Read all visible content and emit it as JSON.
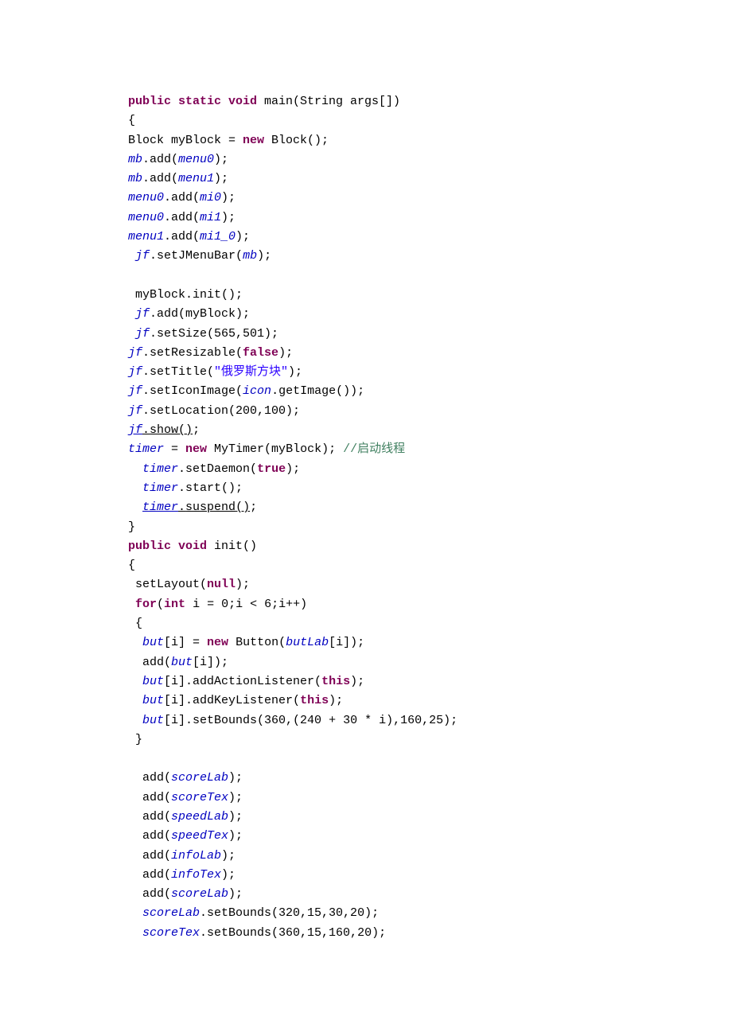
{
  "code_lines": [
    {
      "indent": "",
      "tokens": [
        {
          "class": "kw",
          "text": "public static void"
        },
        {
          "class": "normal",
          "text": " main(String args[])"
        }
      ]
    },
    {
      "indent": "",
      "tokens": [
        {
          "class": "normal",
          "text": "{"
        }
      ]
    },
    {
      "indent": "",
      "tokens": [
        {
          "class": "normal",
          "text": "Block myBlock = "
        },
        {
          "class": "kw",
          "text": "new"
        },
        {
          "class": "normal",
          "text": " Block();"
        }
      ]
    },
    {
      "indent": "",
      "tokens": [
        {
          "class": "field",
          "text": "mb"
        },
        {
          "class": "normal",
          "text": ".add("
        },
        {
          "class": "field",
          "text": "menu0"
        },
        {
          "class": "normal",
          "text": ");"
        }
      ]
    },
    {
      "indent": "",
      "tokens": [
        {
          "class": "field",
          "text": "mb"
        },
        {
          "class": "normal",
          "text": ".add("
        },
        {
          "class": "field",
          "text": "menu1"
        },
        {
          "class": "normal",
          "text": ");"
        }
      ]
    },
    {
      "indent": "",
      "tokens": [
        {
          "class": "field",
          "text": "menu0"
        },
        {
          "class": "normal",
          "text": ".add("
        },
        {
          "class": "field",
          "text": "mi0"
        },
        {
          "class": "normal",
          "text": ");"
        }
      ]
    },
    {
      "indent": "",
      "tokens": [
        {
          "class": "field",
          "text": "menu0"
        },
        {
          "class": "normal",
          "text": ".add("
        },
        {
          "class": "field",
          "text": "mi1"
        },
        {
          "class": "normal",
          "text": ");"
        }
      ]
    },
    {
      "indent": "",
      "tokens": [
        {
          "class": "field",
          "text": "menu1"
        },
        {
          "class": "normal",
          "text": ".add("
        },
        {
          "class": "field",
          "text": "mi1_0"
        },
        {
          "class": "normal",
          "text": ");"
        }
      ]
    },
    {
      "indent": " ",
      "tokens": [
        {
          "class": "field",
          "text": "jf"
        },
        {
          "class": "normal",
          "text": ".setJMenuBar("
        },
        {
          "class": "field",
          "text": "mb"
        },
        {
          "class": "normal",
          "text": ");"
        }
      ]
    },
    {
      "indent": "",
      "tokens": [
        {
          "class": "normal",
          "text": ""
        }
      ]
    },
    {
      "indent": " ",
      "tokens": [
        {
          "class": "normal",
          "text": "myBlock.init();"
        }
      ]
    },
    {
      "indent": " ",
      "tokens": [
        {
          "class": "field",
          "text": "jf"
        },
        {
          "class": "normal",
          "text": ".add(myBlock);"
        }
      ]
    },
    {
      "indent": " ",
      "tokens": [
        {
          "class": "field",
          "text": "jf"
        },
        {
          "class": "normal",
          "text": ".setSize(565,501);"
        }
      ]
    },
    {
      "indent": "",
      "tokens": [
        {
          "class": "field",
          "text": "jf"
        },
        {
          "class": "normal",
          "text": ".setResizable("
        },
        {
          "class": "kw",
          "text": "false"
        },
        {
          "class": "normal",
          "text": ");"
        }
      ]
    },
    {
      "indent": "",
      "tokens": [
        {
          "class": "field",
          "text": "jf"
        },
        {
          "class": "normal",
          "text": ".setTitle("
        },
        {
          "class": "str",
          "text": "\"俄罗斯方块\""
        },
        {
          "class": "normal",
          "text": ");"
        }
      ]
    },
    {
      "indent": "",
      "tokens": [
        {
          "class": "field",
          "text": "jf"
        },
        {
          "class": "normal",
          "text": ".setIconImage("
        },
        {
          "class": "field",
          "text": "icon"
        },
        {
          "class": "normal",
          "text": ".getImage());"
        }
      ]
    },
    {
      "indent": "",
      "tokens": [
        {
          "class": "field",
          "text": "jf"
        },
        {
          "class": "normal",
          "text": ".setLocation(200,100);"
        }
      ]
    },
    {
      "indent": "",
      "tokens": [
        {
          "class": "field underline",
          "text": "jf"
        },
        {
          "class": "normal underline",
          "text": "."
        },
        {
          "class": "normal strike underline",
          "text": "show"
        },
        {
          "class": "normal underline",
          "text": "()"
        },
        {
          "class": "normal",
          "text": ";"
        }
      ]
    },
    {
      "indent": "",
      "tokens": [
        {
          "class": "field",
          "text": "timer"
        },
        {
          "class": "normal",
          "text": " = "
        },
        {
          "class": "kw",
          "text": "new"
        },
        {
          "class": "normal",
          "text": " MyTimer(myBlock); "
        },
        {
          "class": "comment",
          "text": "//启动线程"
        }
      ]
    },
    {
      "indent": "  ",
      "tokens": [
        {
          "class": "field",
          "text": "timer"
        },
        {
          "class": "normal",
          "text": ".setDaemon("
        },
        {
          "class": "kw",
          "text": "true"
        },
        {
          "class": "normal",
          "text": ");"
        }
      ]
    },
    {
      "indent": "  ",
      "tokens": [
        {
          "class": "field",
          "text": "timer"
        },
        {
          "class": "normal",
          "text": ".start();"
        }
      ]
    },
    {
      "indent": "  ",
      "tokens": [
        {
          "class": "field underline",
          "text": "timer"
        },
        {
          "class": "normal underline",
          "text": "."
        },
        {
          "class": "normal strike underline",
          "text": "suspend"
        },
        {
          "class": "normal underline",
          "text": "()"
        },
        {
          "class": "normal",
          "text": ";"
        }
      ]
    },
    {
      "indent": "",
      "tokens": [
        {
          "class": "normal",
          "text": "}"
        }
      ]
    },
    {
      "indent": "",
      "tokens": [
        {
          "class": "kw",
          "text": "public void"
        },
        {
          "class": "normal",
          "text": " init()"
        }
      ]
    },
    {
      "indent": "",
      "tokens": [
        {
          "class": "normal",
          "text": "{"
        }
      ]
    },
    {
      "indent": " ",
      "tokens": [
        {
          "class": "normal",
          "text": "setLayout("
        },
        {
          "class": "kw",
          "text": "null"
        },
        {
          "class": "normal",
          "text": ");"
        }
      ]
    },
    {
      "indent": " ",
      "tokens": [
        {
          "class": "kw",
          "text": "for"
        },
        {
          "class": "normal",
          "text": "("
        },
        {
          "class": "kw",
          "text": "int"
        },
        {
          "class": "normal",
          "text": " i = 0;i < 6;i++)"
        }
      ]
    },
    {
      "indent": " ",
      "tokens": [
        {
          "class": "normal",
          "text": "{"
        }
      ]
    },
    {
      "indent": "  ",
      "tokens": [
        {
          "class": "field",
          "text": "but"
        },
        {
          "class": "normal",
          "text": "[i] = "
        },
        {
          "class": "kw",
          "text": "new"
        },
        {
          "class": "normal",
          "text": " Button("
        },
        {
          "class": "field",
          "text": "butLab"
        },
        {
          "class": "normal",
          "text": "[i]);"
        }
      ]
    },
    {
      "indent": "  ",
      "tokens": [
        {
          "class": "normal",
          "text": "add("
        },
        {
          "class": "field",
          "text": "but"
        },
        {
          "class": "normal",
          "text": "[i]);"
        }
      ]
    },
    {
      "indent": "  ",
      "tokens": [
        {
          "class": "field",
          "text": "but"
        },
        {
          "class": "normal",
          "text": "[i].addActionListener("
        },
        {
          "class": "kw",
          "text": "this"
        },
        {
          "class": "normal",
          "text": ");"
        }
      ]
    },
    {
      "indent": "  ",
      "tokens": [
        {
          "class": "field",
          "text": "but"
        },
        {
          "class": "normal",
          "text": "[i].addKeyListener("
        },
        {
          "class": "kw",
          "text": "this"
        },
        {
          "class": "normal",
          "text": ");"
        }
      ]
    },
    {
      "indent": "  ",
      "tokens": [
        {
          "class": "field",
          "text": "but"
        },
        {
          "class": "normal",
          "text": "[i].setBounds(360,(240 + 30 * i),160,25);"
        }
      ]
    },
    {
      "indent": " ",
      "tokens": [
        {
          "class": "normal",
          "text": "}"
        }
      ]
    },
    {
      "indent": "",
      "tokens": [
        {
          "class": "normal",
          "text": "  "
        }
      ]
    },
    {
      "indent": "  ",
      "tokens": [
        {
          "class": "normal",
          "text": "add("
        },
        {
          "class": "field",
          "text": "scoreLab"
        },
        {
          "class": "normal",
          "text": ");"
        }
      ]
    },
    {
      "indent": "  ",
      "tokens": [
        {
          "class": "normal",
          "text": "add("
        },
        {
          "class": "field",
          "text": "scoreTex"
        },
        {
          "class": "normal",
          "text": ");"
        }
      ]
    },
    {
      "indent": "  ",
      "tokens": [
        {
          "class": "normal",
          "text": "add("
        },
        {
          "class": "field",
          "text": "speedLab"
        },
        {
          "class": "normal",
          "text": ");"
        }
      ]
    },
    {
      "indent": "  ",
      "tokens": [
        {
          "class": "normal",
          "text": "add("
        },
        {
          "class": "field",
          "text": "speedTex"
        },
        {
          "class": "normal",
          "text": ");"
        }
      ]
    },
    {
      "indent": "  ",
      "tokens": [
        {
          "class": "normal",
          "text": "add("
        },
        {
          "class": "field",
          "text": "infoLab"
        },
        {
          "class": "normal",
          "text": ");"
        }
      ]
    },
    {
      "indent": "  ",
      "tokens": [
        {
          "class": "normal",
          "text": "add("
        },
        {
          "class": "field",
          "text": "infoTex"
        },
        {
          "class": "normal",
          "text": ");"
        }
      ]
    },
    {
      "indent": "  ",
      "tokens": [
        {
          "class": "normal",
          "text": "add("
        },
        {
          "class": "field",
          "text": "scoreLab"
        },
        {
          "class": "normal",
          "text": ");"
        }
      ]
    },
    {
      "indent": "  ",
      "tokens": [
        {
          "class": "field",
          "text": "scoreLab"
        },
        {
          "class": "normal",
          "text": ".setBounds(320,15,30,20);"
        }
      ]
    },
    {
      "indent": "  ",
      "tokens": [
        {
          "class": "field",
          "text": "scoreTex"
        },
        {
          "class": "normal",
          "text": ".setBounds(360,15,160,20);"
        }
      ]
    }
  ]
}
